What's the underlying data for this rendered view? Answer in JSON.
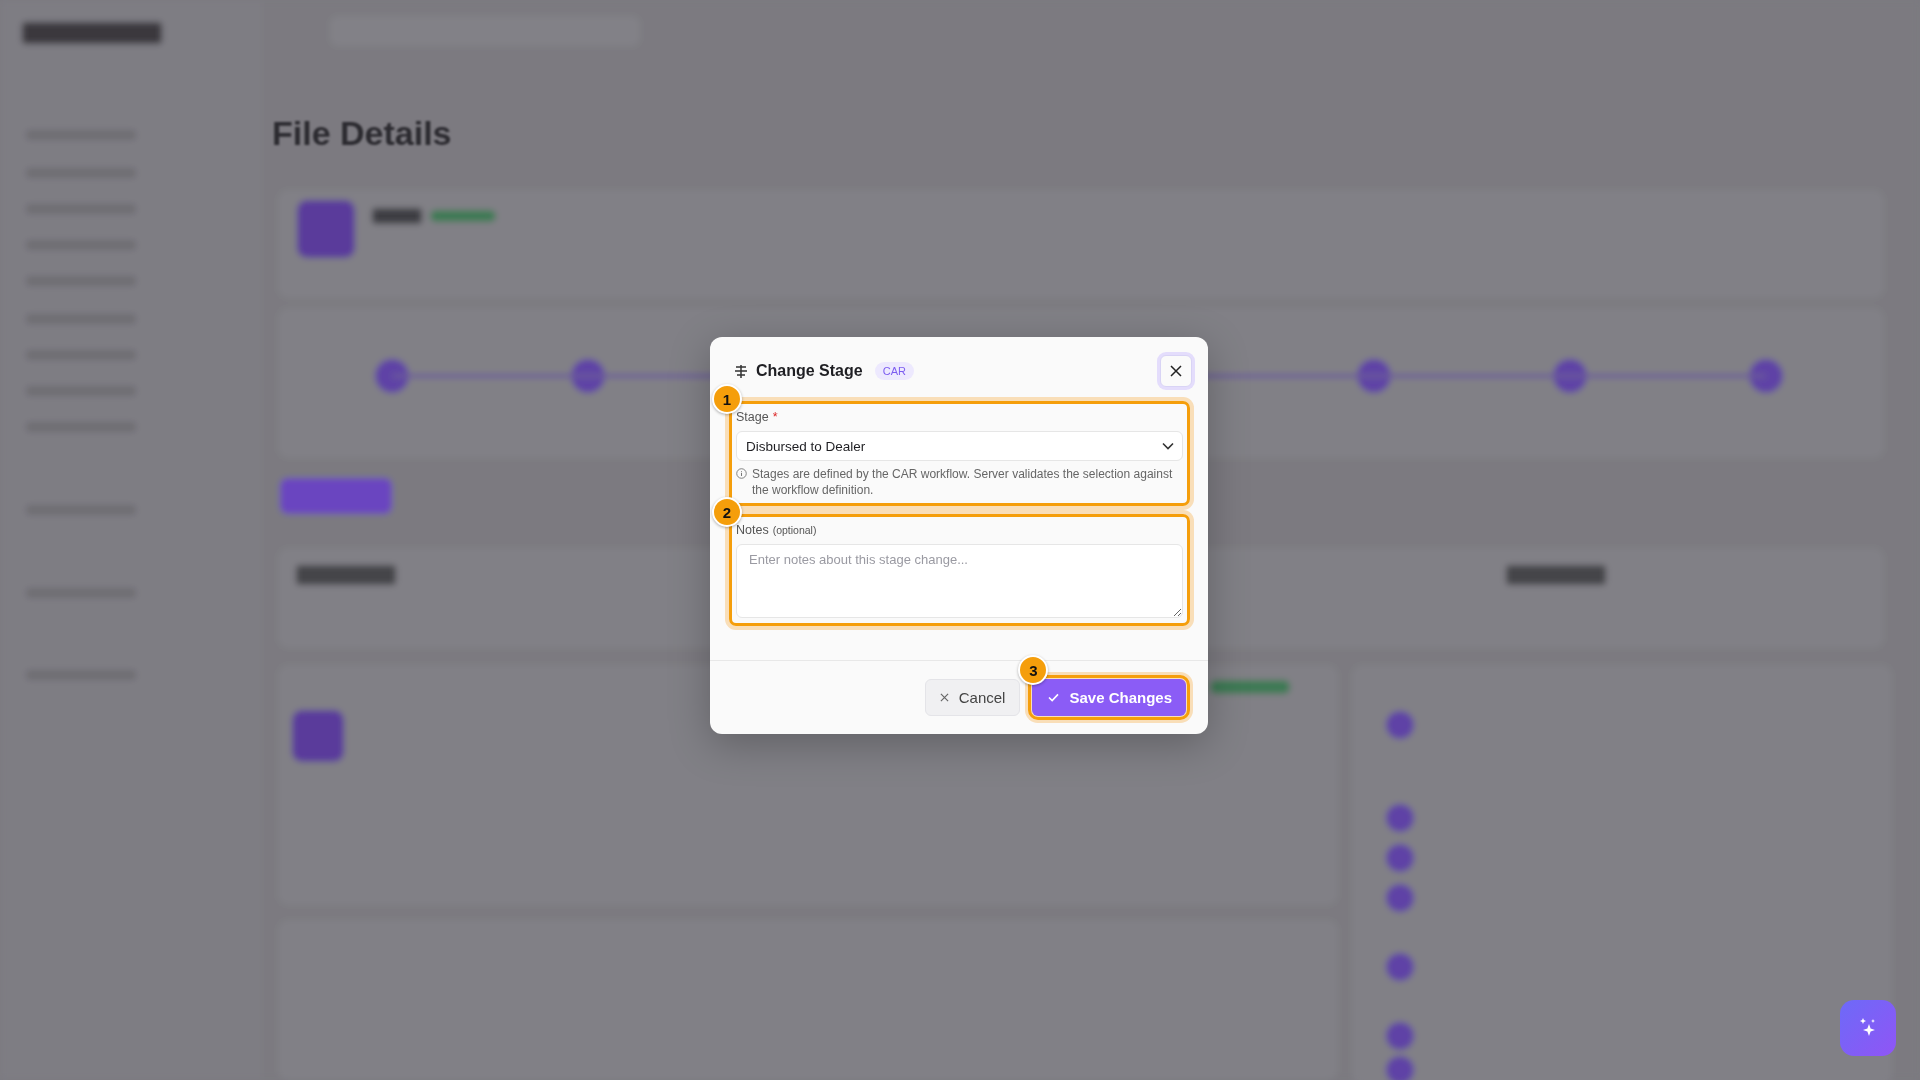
{
  "page_title": "File Details",
  "dialog": {
    "title": "Change Stage",
    "tag": "CAR",
    "fields": [
      {
        "kind": "select",
        "label": "Stage",
        "required_mark": "*",
        "value": "Disbursed to Dealer",
        "help": "Stages are defined by the CAR workflow. Server validates the selection against the workflow definition.",
        "step": "1"
      },
      {
        "kind": "textarea",
        "label": "Notes",
        "hint": "(optional)",
        "placeholder": "Enter notes about this stage change...",
        "step": "2"
      }
    ],
    "buttons": [
      {
        "kind": "secondary",
        "label": "Cancel"
      },
      {
        "kind": "primary",
        "label": "Save Changes",
        "step": "3"
      }
    ]
  }
}
